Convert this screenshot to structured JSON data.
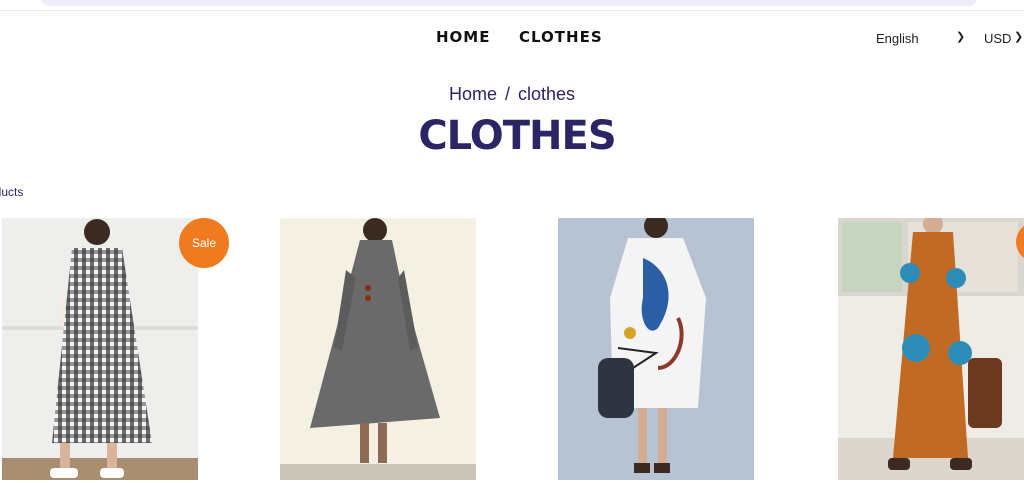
{
  "nav": {
    "home_label": "HOME",
    "clothes_label": "CLOTHES"
  },
  "header": {
    "language": "English",
    "currency": "USD"
  },
  "breadcrumb": {
    "home": "Home",
    "separator": "/",
    "current": "clothes"
  },
  "page": {
    "title": "CLOTHES",
    "products_label": "oducts"
  },
  "products": [
    {
      "image": "black and white gingham shirt dress",
      "badge": "Sale"
    },
    {
      "image": "grey turtleneck a-line dress",
      "badge": ""
    },
    {
      "image": "white printed short-sleeve dress",
      "badge": ""
    },
    {
      "image": "rust floral long shirt dress",
      "badge": ""
    }
  ],
  "colors": {
    "accent": "#2b2566",
    "badge": "#f07a1f",
    "text": "#111111"
  }
}
